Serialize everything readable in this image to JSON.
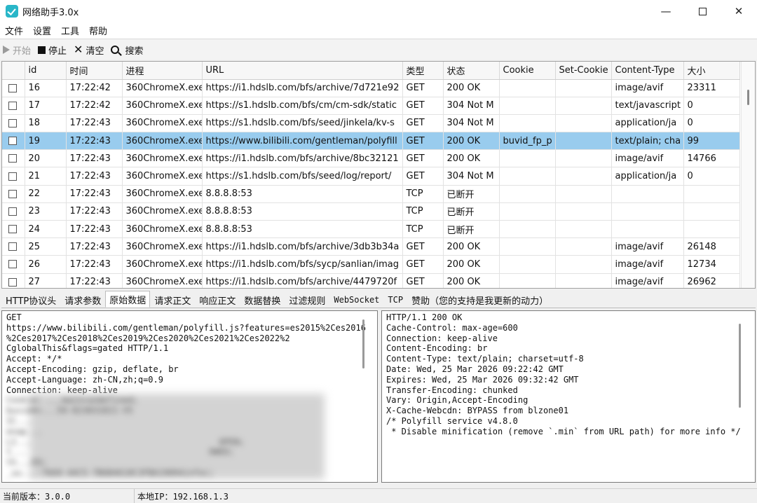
{
  "window": {
    "title": "网络助手3.0x",
    "controls": {
      "minimize": "—",
      "close": "✕"
    }
  },
  "menu": [
    "文件",
    "设置",
    "工具",
    "帮助"
  ],
  "toolbar": {
    "start_label": "开始",
    "stop_label": "停止",
    "clear_label": "清空",
    "search_label": "搜索"
  },
  "table": {
    "columns": [
      "id",
      "时间",
      "进程",
      "URL",
      "类型",
      "状态",
      "Cookie",
      "Set-Cookie",
      "Content-Type",
      "大小"
    ],
    "rows": [
      {
        "id": "16",
        "time": "17:22:42",
        "process": "360ChromeX.exe",
        "url": "https://i1.hdslb.com/bfs/archive/7d721e92",
        "type": "GET",
        "status": "200 OK",
        "cookie": "",
        "set_cookie": "",
        "content_type": "image/avif",
        "size": "23311",
        "selected": false
      },
      {
        "id": "17",
        "time": "17:22:42",
        "process": "360ChromeX.exe",
        "url": "https://s1.hdslb.com/bfs/cm/cm-sdk/static",
        "type": "GET",
        "status": "304 Not M",
        "cookie": "",
        "set_cookie": "",
        "content_type": "text/javascript",
        "size": "0",
        "selected": false
      },
      {
        "id": "18",
        "time": "17:22:43",
        "process": "360ChromeX.exe",
        "url": "https://s1.hdslb.com/bfs/seed/jinkela/kv-s",
        "type": "GET",
        "status": "304 Not M",
        "cookie": "",
        "set_cookie": "",
        "content_type": "application/ja",
        "size": "0",
        "selected": false
      },
      {
        "id": "19",
        "time": "17:22:43",
        "process": "360ChromeX.exe",
        "url": "https://www.bilibili.com/gentleman/polyfill",
        "type": "GET",
        "status": "200 OK",
        "cookie": "buvid_fp_p",
        "set_cookie": "",
        "content_type": "text/plain; cha",
        "size": "99",
        "selected": true
      },
      {
        "id": "20",
        "time": "17:22:43",
        "process": "360ChromeX.exe",
        "url": "https://i1.hdslb.com/bfs/archive/8bc32121",
        "type": "GET",
        "status": "200 OK",
        "cookie": "",
        "set_cookie": "",
        "content_type": "image/avif",
        "size": "14766",
        "selected": false
      },
      {
        "id": "21",
        "time": "17:22:43",
        "process": "360ChromeX.exe",
        "url": "https://s1.hdslb.com/bfs/seed/log/report/",
        "type": "GET",
        "status": "304 Not M",
        "cookie": "",
        "set_cookie": "",
        "content_type": "application/ja",
        "size": "0",
        "selected": false
      },
      {
        "id": "22",
        "time": "17:22:43",
        "process": "360ChromeX.exe",
        "url": "8.8.8.8:53",
        "type": "TCP",
        "status": "已断开",
        "cookie": "",
        "set_cookie": "",
        "content_type": "",
        "size": "",
        "selected": false
      },
      {
        "id": "23",
        "time": "17:22:43",
        "process": "360ChromeX.exe",
        "url": "8.8.8.8:53",
        "type": "TCP",
        "status": "已断开",
        "cookie": "",
        "set_cookie": "",
        "content_type": "",
        "size": "",
        "selected": false
      },
      {
        "id": "24",
        "time": "17:22:43",
        "process": "360ChromeX.exe",
        "url": "8.8.8.8:53",
        "type": "TCP",
        "status": "已断开",
        "cookie": "",
        "set_cookie": "",
        "content_type": "",
        "size": "",
        "selected": false
      },
      {
        "id": "25",
        "time": "17:22:43",
        "process": "360ChromeX.exe",
        "url": "https://i1.hdslb.com/bfs/archive/3db3b34a",
        "type": "GET",
        "status": "200 OK",
        "cookie": "",
        "set_cookie": "",
        "content_type": "image/avif",
        "size": "26148",
        "selected": false
      },
      {
        "id": "26",
        "time": "17:22:43",
        "process": "360ChromeX.exe",
        "url": "https://i1.hdslb.com/bfs/sycp/sanlian/imag",
        "type": "GET",
        "status": "200 OK",
        "cookie": "",
        "set_cookie": "",
        "content_type": "image/avif",
        "size": "12734",
        "selected": false
      },
      {
        "id": "27",
        "time": "17:22:43",
        "process": "360ChromeX.exe",
        "url": "https://i1.hdslb.com/bfs/archive/4479720f",
        "type": "GET",
        "status": "200 OK",
        "cookie": "",
        "set_cookie": "",
        "content_type": "image/avif",
        "size": "26962",
        "selected": false
      }
    ]
  },
  "tabs": [
    {
      "label": "HTTP协议头",
      "active": false,
      "mono": false
    },
    {
      "label": "请求参数",
      "active": false,
      "mono": false
    },
    {
      "label": "原始数据",
      "active": true,
      "mono": false
    },
    {
      "label": "请求正文",
      "active": false,
      "mono": false
    },
    {
      "label": "响应正文",
      "active": false,
      "mono": false
    },
    {
      "label": "数据替换",
      "active": false,
      "mono": false
    },
    {
      "label": "过滤规则",
      "active": false,
      "mono": false
    },
    {
      "label": "WebSocket",
      "active": false,
      "mono": true
    },
    {
      "label": "TCP",
      "active": false,
      "mono": true
    },
    {
      "label": "赞助（您的支持是我更新的动力）",
      "active": false,
      "mono": false
    }
  ],
  "request_pane": {
    "lines": [
      "GET",
      "https://www.bilibili.com/gentleman/polyfill.js?features=es2015%2Ces2016",
      "%2Ces2017%2Ces2018%2Ces2019%2Ces2020%2Ces2021%2Ces2022%2",
      "CglobalThis&flags=gated HTTP/1.1",
      "Accept: */*",
      "Accept-Encoding: gzip, deflate, br",
      "Accept-Language: zh-CN,zh;q=0.9",
      "Connection: keep-alive",
      "Cookie: ...main=undefined;",
      "buvid4=...59-023031021-V5",
      "IC...",
      "enap...",
      "LI...                                     OPEN;",
      "t...                                    OWED;",
      "th...ED;",
      "_uu...-7669-44C5-7B6B4610C3FBA19094infoc;"
    ]
  },
  "response_pane": {
    "lines": [
      "HTTP/1.1 200 OK",
      "Cache-Control: max-age=600",
      "Connection: keep-alive",
      "Content-Encoding: br",
      "Content-Type: text/plain; charset=utf-8",
      "Date: Wed, 25 Mar 2026 09:22:42 GMT",
      "Expires: Wed, 25 Mar 2026 09:32:42 GMT",
      "Transfer-Encoding: chunked",
      "Vary: Origin,Accept-Encoding",
      "X-Cache-Webcdn: BYPASS from blzone01",
      "",
      "",
      "/* Polyfill service v4.8.0",
      " * Disable minification (remove `.min` from URL path) for more info */"
    ]
  },
  "status": {
    "version": "当前版本：3.0.0",
    "ip": "本地IP：192.168.1.3"
  }
}
